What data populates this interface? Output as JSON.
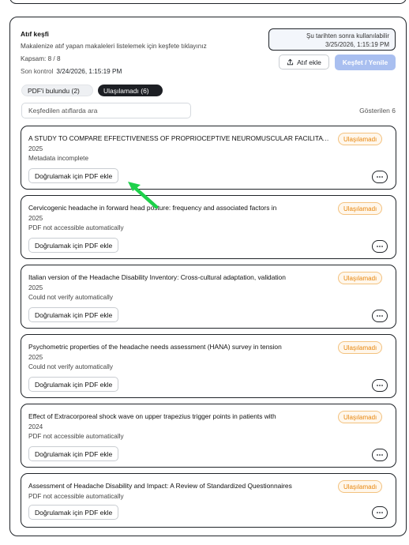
{
  "panel": {
    "title": "Atıf keşfi",
    "subtitle": "Makalenize atıf yapan makaleleri listelemek için keşfete tıklayınız",
    "coverage_label": "Kapsam:",
    "coverage_value": "8 / 8",
    "last_check_label": "Son kontrol",
    "last_check_value": "3/24/2026, 1:15:19 PM",
    "use_after_line1": "Şu tarihten sonra kullanılabilir",
    "use_after_line2": "3/25/2026, 1:15:19 PM",
    "add_citation_label": "Atıf ekle",
    "discover_label": "Keşfet / Yenile",
    "tabs": [
      {
        "label": "PDF'i bulundu (2)",
        "active": false
      },
      {
        "label": "Ulaşılamadı (6)",
        "active": true
      }
    ],
    "search_placeholder": "Keşfedilen atıflarda ara",
    "shown_label": "Gösterilen 6"
  },
  "results": [
    {
      "title": "A STUDY TO COMPARE EFFECTIVENESS OF PROPRIOCEPTIVE NEUROMUSCULAR FACILITATION",
      "year": "2025",
      "note": "Metadata incomplete",
      "status": "Ulaşılamadı",
      "action": "Doğrulamak için PDF ekle"
    },
    {
      "title": "Cervicogenic headache in forward head posture: frequency and associated factors in",
      "year": "2025",
      "note": "PDF not accessible automatically",
      "status": "Ulaşılamadı",
      "action": "Doğrulamak için PDF ekle"
    },
    {
      "title": "Italian version of the Headache Disability Inventory: Cross-cultural adaptation, validation",
      "year": "2025",
      "note": "Could not verify automatically",
      "status": "Ulaşılamadı",
      "action": "Doğrulamak için PDF ekle"
    },
    {
      "title": "Psychometric properties of the headache needs assessment (HANA) survey in tension",
      "year": "2025",
      "note": "Could not verify automatically",
      "status": "Ulaşılamadı",
      "action": "Doğrulamak için PDF ekle"
    },
    {
      "title": "Effect of Extracorporeal shock wave on upper trapezius trigger points in patients with",
      "year": "2024",
      "note": "PDF not accessible automatically",
      "status": "Ulaşılamadı",
      "action": "Doğrulamak için PDF ekle"
    },
    {
      "title": "Assessment of Headache Disability and Impact: A Review of Standardized Questionnaires",
      "year": "",
      "note": "PDF not accessible automatically",
      "status": "Ulaşılamadı",
      "action": "Doğrulamak için PDF ekle"
    }
  ],
  "icons": {
    "upload": "upload-icon",
    "more": "more-options-icon",
    "pointer": "pointer-arrow-icon"
  },
  "colors": {
    "accent": "#a9bff0",
    "status_orange": "#e8860c",
    "status_bg": "#fff7ec",
    "dark_pill": "#1d1f24",
    "pointer_green": "#1ed14b"
  }
}
